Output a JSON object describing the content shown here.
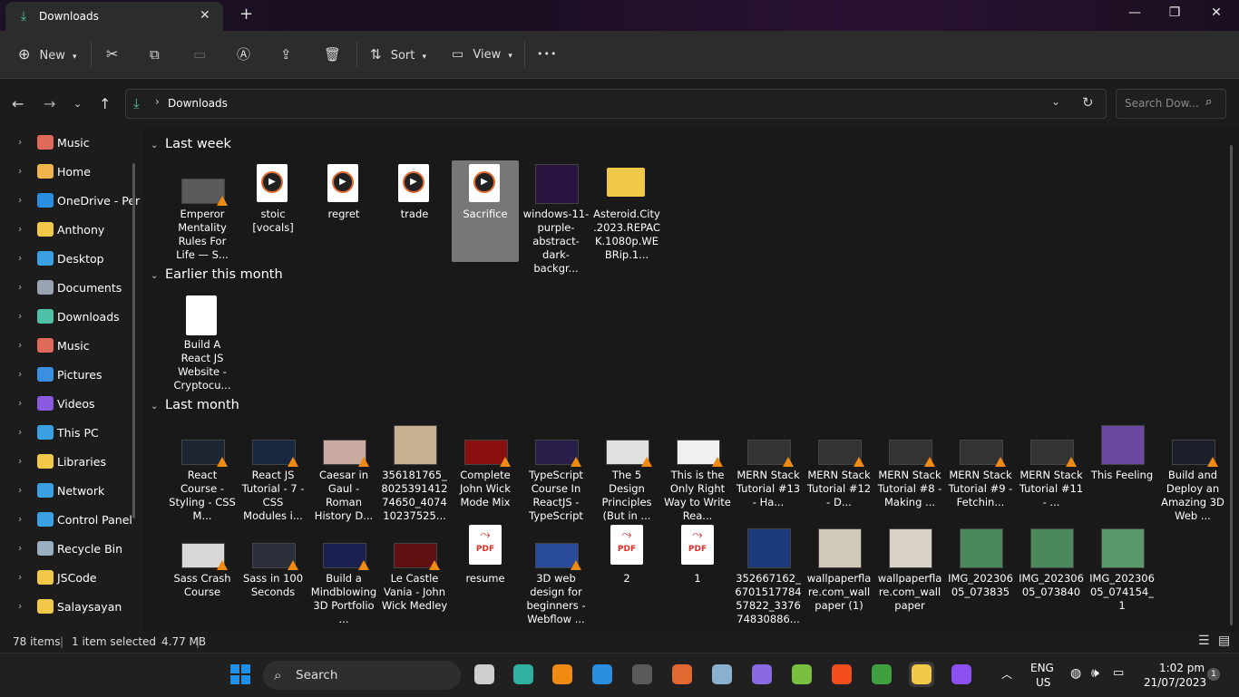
{
  "window": {
    "tab_title": "Downloads",
    "new_tab": "+",
    "minimize": "—",
    "maximize": "❐",
    "close": "✕"
  },
  "toolbar": {
    "new_label": "New",
    "sort_label": "Sort",
    "view_label": "View",
    "more_label": "•••"
  },
  "address": {
    "location": "Downloads",
    "search_placeholder": "Search Dow..."
  },
  "sidebar": {
    "items": [
      {
        "label": "Music",
        "icon": "music-icon",
        "color": "#e06a5a"
      },
      {
        "label": "Home",
        "icon": "home-icon",
        "color": "#f0b44c"
      },
      {
        "label": "OneDrive - Per",
        "icon": "cloud-icon",
        "color": "#2a8fe0"
      },
      {
        "label": "Anthony",
        "icon": "folder-icon",
        "color": "#f2c84b"
      },
      {
        "label": "Desktop",
        "icon": "desktop-icon",
        "color": "#3aa0e0"
      },
      {
        "label": "Documents",
        "icon": "documents-icon",
        "color": "#9aa4b0"
      },
      {
        "label": "Downloads",
        "icon": "download-icon",
        "color": "#4fc1a6"
      },
      {
        "label": "Music",
        "icon": "music-icon",
        "color": "#e06a5a"
      },
      {
        "label": "Pictures",
        "icon": "pictures-icon",
        "color": "#3a8fe0"
      },
      {
        "label": "Videos",
        "icon": "videos-icon",
        "color": "#8a5ae0"
      },
      {
        "label": "This PC",
        "icon": "computer-icon",
        "color": "#3aa0e0"
      },
      {
        "label": "Libraries",
        "icon": "folder-icon",
        "color": "#f2c84b"
      },
      {
        "label": "Network",
        "icon": "network-icon",
        "color": "#3aa0e0"
      },
      {
        "label": "Control Panel",
        "icon": "control-panel-icon",
        "color": "#3aa0e0"
      },
      {
        "label": "Recycle Bin",
        "icon": "recycle-bin-icon",
        "color": "#9ab0c0"
      },
      {
        "label": "JSCode",
        "icon": "folder-icon",
        "color": "#f2c84b"
      },
      {
        "label": "Salaysayan",
        "icon": "folder-icon",
        "color": "#f2c84b"
      }
    ]
  },
  "groups": [
    {
      "title": "Last week",
      "items": [
        {
          "name": "Emperor Mentality Rules For Life — S...",
          "kind": "video-thumb",
          "color": "#5a5a5a"
        },
        {
          "name": "stoic [vocals]",
          "kind": "media-file",
          "color": "#ffffff"
        },
        {
          "name": "regret",
          "kind": "media-file",
          "color": "#ffffff"
        },
        {
          "name": "trade",
          "kind": "media-file",
          "color": "#ffffff"
        },
        {
          "name": "Sacrifice",
          "kind": "media-file",
          "color": "#ffffff",
          "selected": true
        },
        {
          "name": "windows-11-purple-abstract-dark-backgr...",
          "kind": "image-thumb",
          "color": "#2a1540"
        },
        {
          "name": "Asteroid.City.2023.REPACK.1080p.WEBRip.1...",
          "kind": "folder",
          "color": "#f2c84b"
        }
      ]
    },
    {
      "title": "Earlier this month",
      "items": [
        {
          "name": "Build A React JS Website - Cryptocu...",
          "kind": "blank-file",
          "color": "#ffffff"
        }
      ]
    },
    {
      "title": "Last month",
      "items": [
        {
          "name": "React Course - Styling - CSS M...",
          "kind": "video-thumb",
          "color": "#1e2533"
        },
        {
          "name": "React JS Tutorial - 7 - CSS Modules i...",
          "kind": "video-thumb",
          "color": "#1a2740"
        },
        {
          "name": "Caesar in Gaul - Roman History D...",
          "kind": "video-thumb",
          "color": "#c9a9a0"
        },
        {
          "name": "356181765_802539141274650_407410237525...",
          "kind": "image-thumb",
          "color": "#c8b090"
        },
        {
          "name": "Complete John Wick Mode Mix",
          "kind": "video-thumb",
          "color": "#8a1010"
        },
        {
          "name": "TypeScript Course In ReactJS - TypeScript",
          "kind": "video-thumb",
          "color": "#2a1f4a"
        },
        {
          "name": "The 5 Design Principles (But in ...",
          "kind": "video-thumb",
          "color": "#e0e0e0"
        },
        {
          "name": "This is the Only Right Way to Write Rea...",
          "kind": "video-thumb",
          "color": "#f0f0f0"
        },
        {
          "name": "MERN Stack Tutorial #13 - Ha...",
          "kind": "video-thumb",
          "color": "#333333"
        },
        {
          "name": "MERN Stack Tutorial #12 - D...",
          "kind": "video-thumb",
          "color": "#333333"
        },
        {
          "name": "MERN Stack Tutorial #8 - Making ...",
          "kind": "video-thumb",
          "color": "#333333"
        },
        {
          "name": "MERN Stack Tutorial #9 - Fetchin...",
          "kind": "video-thumb",
          "color": "#333333"
        },
        {
          "name": "MERN Stack Tutorial #11 - ...",
          "kind": "video-thumb",
          "color": "#333333"
        },
        {
          "name": "This Feeling",
          "kind": "image-thumb",
          "color": "#6a4aa0"
        },
        {
          "name": "Build and Deploy an Amazing 3D Web ...",
          "kind": "video-thumb",
          "color": "#1a1f2a"
        },
        {
          "name": "Sass Crash Course",
          "kind": "video-thumb",
          "color": "#d8d8d8"
        },
        {
          "name": "Sass in 100 Seconds",
          "kind": "video-thumb",
          "color": "#2a2f3a"
        },
        {
          "name": "Build a Mindblowing 3D Portfolio ...",
          "kind": "video-thumb",
          "color": "#1a2050"
        },
        {
          "name": "Le Castle Vania - John Wick Medley",
          "kind": "video-thumb",
          "color": "#601010"
        },
        {
          "name": "resume",
          "kind": "pdf",
          "color": "#d9302a"
        },
        {
          "name": "3D web design for beginners - Webflow ...",
          "kind": "video-thumb",
          "color": "#2a4a9a"
        },
        {
          "name": "2",
          "kind": "pdf",
          "color": "#d9302a"
        },
        {
          "name": "1",
          "kind": "pdf",
          "color": "#d9302a"
        },
        {
          "name": "352667162_670151778457822_337674830886...",
          "kind": "image-thumb",
          "color": "#1a3a7a"
        },
        {
          "name": "wallpaperflare.com_wallpaper (1)",
          "kind": "image-thumb",
          "color": "#d0c8b8"
        },
        {
          "name": "wallpaperflare.com_wallpaper",
          "kind": "image-thumb",
          "color": "#d8d2c8"
        },
        {
          "name": "IMG_20230605_073835",
          "kind": "image-thumb",
          "color": "#4a8a5a"
        },
        {
          "name": "IMG_20230605_073840",
          "kind": "image-thumb",
          "color": "#4a8a5a"
        },
        {
          "name": "IMG_20230605_074154_1",
          "kind": "image-thumb",
          "color": "#5a9a6a"
        }
      ]
    }
  ],
  "pdf_label": "PDF",
  "status": {
    "count": "78 items",
    "selection": "1 item selected",
    "size": "4.77 MB"
  },
  "taskbar": {
    "search_label": "Search",
    "language": "ENG",
    "region": "US",
    "time": "1:02 pm",
    "date": "21/07/2023",
    "notification_count": "1",
    "apps": [
      {
        "name": "task-view-icon",
        "color": "#cfcfcf"
      },
      {
        "name": "edge-icon",
        "color": "#2fb0a0"
      },
      {
        "name": "vlc-icon",
        "color": "#f08a10"
      },
      {
        "name": "vscode-icon",
        "color": "#2a8fe0"
      },
      {
        "name": "terminal-icon",
        "color": "#5a5a5a"
      },
      {
        "name": "media-player-icon",
        "color": "#e06a30"
      },
      {
        "name": "photos-icon",
        "color": "#8ab0d0"
      },
      {
        "name": "github-icon",
        "color": "#8a6ae0"
      },
      {
        "name": "android-icon",
        "color": "#7ac040"
      },
      {
        "name": "figma-icon",
        "color": "#f24e1e"
      },
      {
        "name": "mongodb-icon",
        "color": "#40a040"
      },
      {
        "name": "file-explorer-icon",
        "color": "#f2c84b"
      },
      {
        "name": "messenger-icon",
        "color": "#8a50f0"
      }
    ]
  }
}
